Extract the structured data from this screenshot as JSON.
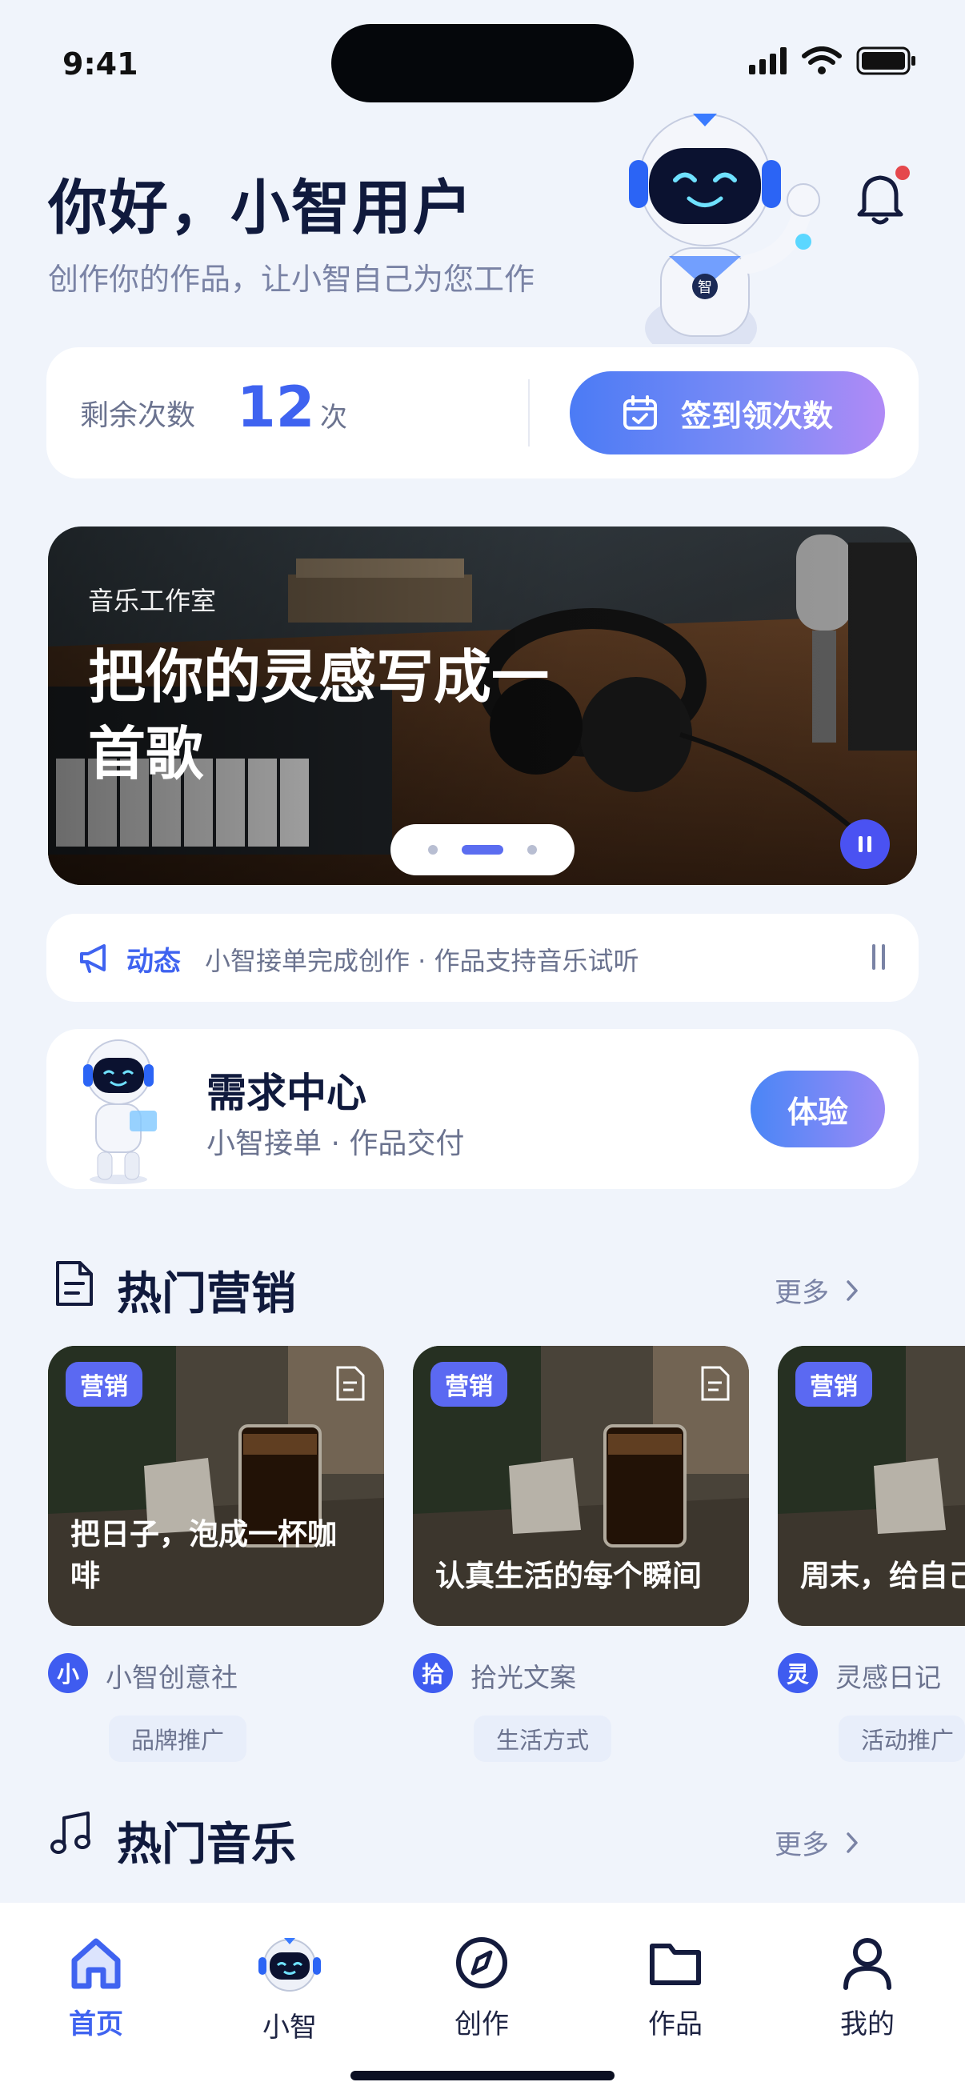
{
  "status": {
    "time": "9:41"
  },
  "greeting": {
    "title": "你好，小智用户",
    "subtitle": "创作你的作品，让小智自己为您工作"
  },
  "credits": {
    "label": "剩余次数",
    "value": "12",
    "unit": "次",
    "checkin_label": "签到领次数"
  },
  "banner": {
    "tag": "音乐工作室",
    "title": "把你的灵感写成一首歌",
    "page_count": 3,
    "active_page": 1
  },
  "news": {
    "label": "动态",
    "text": "小智接单完成创作 · 作品支持音乐试听"
  },
  "demand": {
    "title": "需求中心",
    "subtitle": "小智接单 · 作品交付",
    "button_label": "体验"
  },
  "marketing": {
    "title": "热门营销",
    "more_label": "更多",
    "cards": [
      {
        "badge": "营销",
        "text": "把日子，泡成一杯咖啡",
        "author_avatar": "小",
        "author": "小智创意社",
        "tag": "品牌推广"
      },
      {
        "badge": "营销",
        "text": "认真生活的每个瞬间",
        "author_avatar": "拾",
        "author": "拾光文案",
        "tag": "生活方式"
      },
      {
        "badge": "营销",
        "text": "周末，给自己",
        "author_avatar": "灵",
        "author": "灵感日记",
        "tag": "活动推广"
      }
    ]
  },
  "music": {
    "title": "热门音乐",
    "more_label": "更多"
  },
  "nav": {
    "items": [
      {
        "label": "首页",
        "icon": "home-icon",
        "active": true
      },
      {
        "label": "小智",
        "icon": "robot-avatar-icon",
        "active": false
      },
      {
        "label": "创作",
        "icon": "compass-icon",
        "active": false
      },
      {
        "label": "作品",
        "icon": "folder-icon",
        "active": false
      },
      {
        "label": "我的",
        "icon": "user-icon",
        "active": false
      }
    ]
  },
  "colors": {
    "accent": "#3F63F0",
    "background": "#F0F4FB",
    "badge": "#5B69F2"
  }
}
